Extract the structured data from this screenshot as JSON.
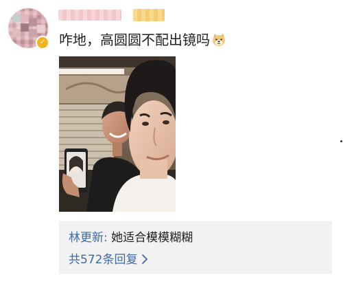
{
  "post": {
    "text": "咋地，高圆圆不配出镜吗",
    "emoji": "doge-emoji"
  },
  "comment": {
    "user": "林更新",
    "separator": ": ",
    "text": "她适合模模糊糊"
  },
  "replies": {
    "label": "共572条回复"
  },
  "colors": {
    "link_blue": "#3f6aa8",
    "comment_bg": "#f2f2f2",
    "badge": "#f4b21b"
  }
}
